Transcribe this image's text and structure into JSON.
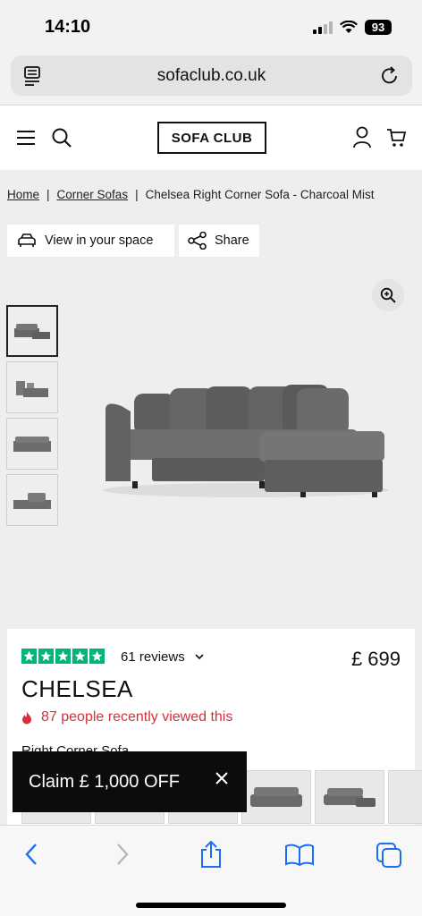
{
  "status": {
    "time": "14:10",
    "battery": "93"
  },
  "browser": {
    "url": "sofaclub.co.uk"
  },
  "site": {
    "logo": "SOFA CLUB"
  },
  "breadcrumb": {
    "home": "Home",
    "category": "Corner Sofas",
    "current": "Chelsea Right Corner Sofa - Charcoal Mist",
    "separator": "|"
  },
  "actions": {
    "view_in_space": "View in your space",
    "share": "Share"
  },
  "product": {
    "rating_stars": 5,
    "reviews": "61 reviews",
    "price": "£ 699",
    "name": "CHELSEA",
    "viewed": "87 people recently viewed this",
    "variant_label": "Right Corner Sofa"
  },
  "promo": {
    "claim": "Claim £ 1,000 OFF"
  },
  "colors": {
    "trustpilot_green": "#00b67a",
    "alert_red": "#d6303a",
    "ios_blue": "#1a6ef5",
    "sofa_grey": "#6a6a6a"
  }
}
